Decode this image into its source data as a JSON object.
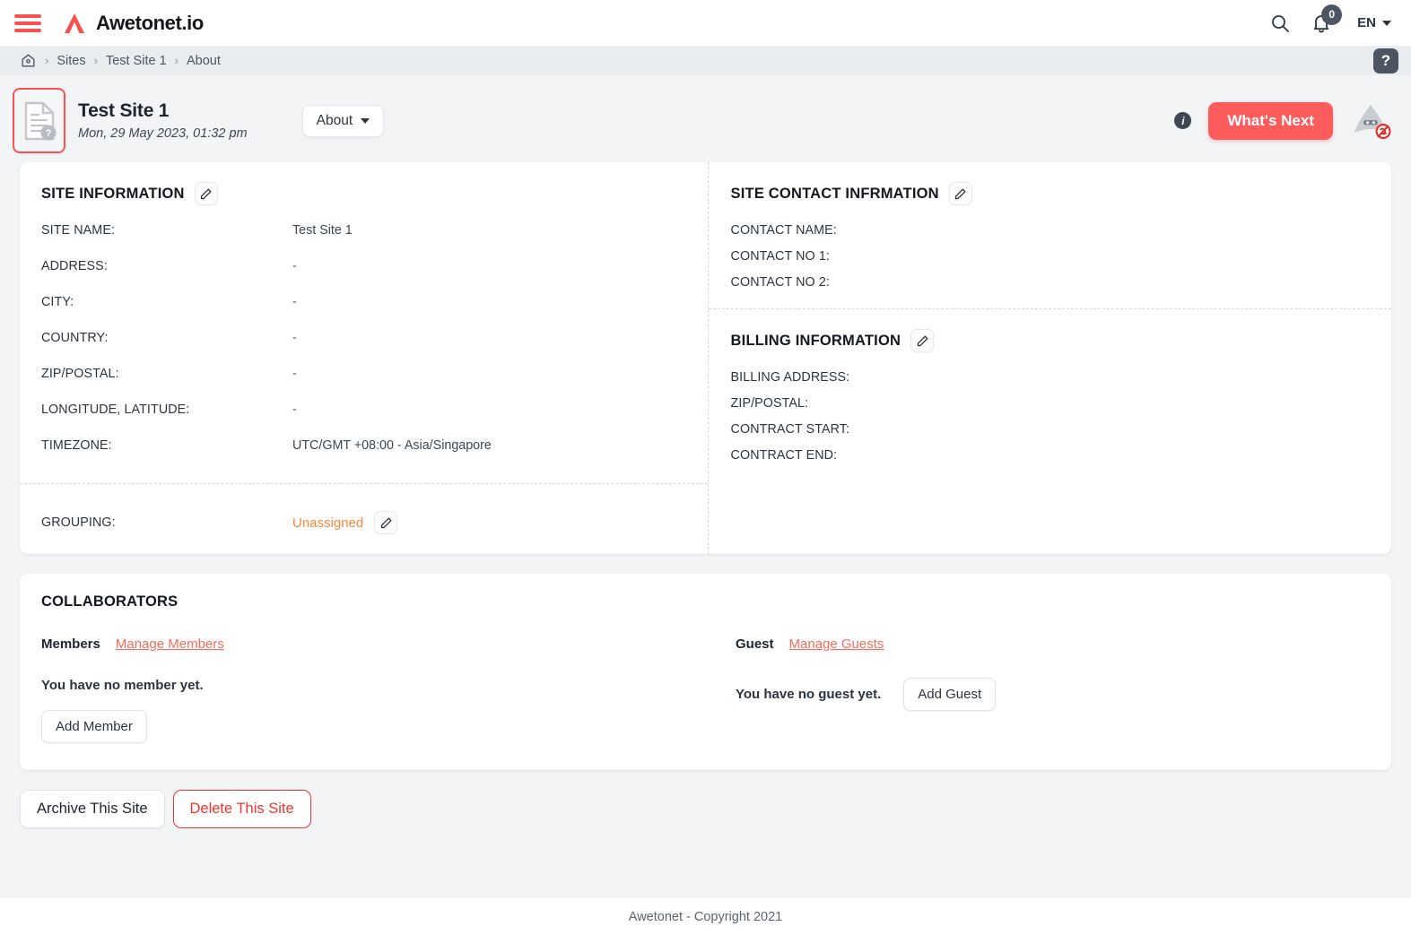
{
  "navbar": {
    "menu_icon": "hamburger-menu-icon",
    "brand_name": "Awetonet.io",
    "search_icon": "search-icon",
    "bell_icon": "bell-icon",
    "notification_count": "0",
    "language": "EN"
  },
  "breadcrumb": {
    "home_icon": "home-icon",
    "sep": "›",
    "items": [
      {
        "label": "Sites"
      },
      {
        "label": "Test Site 1"
      },
      {
        "label": "About"
      }
    ],
    "help_label": "?"
  },
  "site_header": {
    "icon": "document-question-icon",
    "title": "Test Site 1",
    "date": "Mon, 29 May 2023, 01:32 pm",
    "view_selector": "About",
    "info_label": "i",
    "whats_next": "What's Next",
    "ninja_icon": "ninja-offline-icon"
  },
  "site_information": {
    "title": "SITE INFORMATION",
    "edit_icon": "pencil-icon",
    "fields": [
      {
        "label": "SITE NAME:",
        "value": "Test Site 1"
      },
      {
        "label": "ADDRESS:",
        "value": "-"
      },
      {
        "label": "CITY:",
        "value": "-"
      },
      {
        "label": "COUNTRY:",
        "value": "-"
      },
      {
        "label": "ZIP/POSTAL:",
        "value": "-"
      },
      {
        "label": "LONGITUDE, LATITUDE:",
        "value": "-"
      },
      {
        "label": "TIMEZONE:",
        "value": "UTC/GMT +08:00 - Asia/Singapore"
      }
    ],
    "grouping_label": "GROUPING:",
    "grouping_value": "Unassigned",
    "grouping_edit_icon": "pencil-icon"
  },
  "site_contact": {
    "title": "SITE CONTACT INFRMATION",
    "edit_icon": "pencil-icon",
    "fields": [
      {
        "label": "CONTACT NAME:",
        "value": ""
      },
      {
        "label": "CONTACT NO 1:",
        "value": ""
      },
      {
        "label": "CONTACT NO 2:",
        "value": ""
      }
    ]
  },
  "billing": {
    "title": "BILLING INFORMATION",
    "edit_icon": "pencil-icon",
    "fields": [
      {
        "label": "BILLING ADDRESS:",
        "value": ""
      },
      {
        "label": "ZIP/POSTAL:",
        "value": ""
      },
      {
        "label": "CONTRACT START:",
        "value": ""
      },
      {
        "label": "CONTRACT END:",
        "value": ""
      }
    ]
  },
  "collaborators": {
    "title": "COLLABORATORS",
    "members": {
      "label": "Members",
      "manage_link": "Manage Members",
      "empty_text": "You have no member yet.",
      "add_button": "Add Member"
    },
    "guests": {
      "label": "Guest",
      "manage_link": "Manage Guests",
      "empty_text": "You have no guest yet.",
      "add_button": "Add Guest"
    }
  },
  "actions": {
    "archive": "Archive This Site",
    "delete": "Delete This Site"
  },
  "footer": {
    "text": "Awetonet - Copyright 2021"
  },
  "colors": {
    "brand_red": "#f9514f",
    "accent_red": "#fc5c5c",
    "link_red": "#fa6a5a",
    "orange": "#f58a3e",
    "delete_red": "#f4342e",
    "slate": "#4d5562",
    "page_bg": "#f2f4f6"
  }
}
